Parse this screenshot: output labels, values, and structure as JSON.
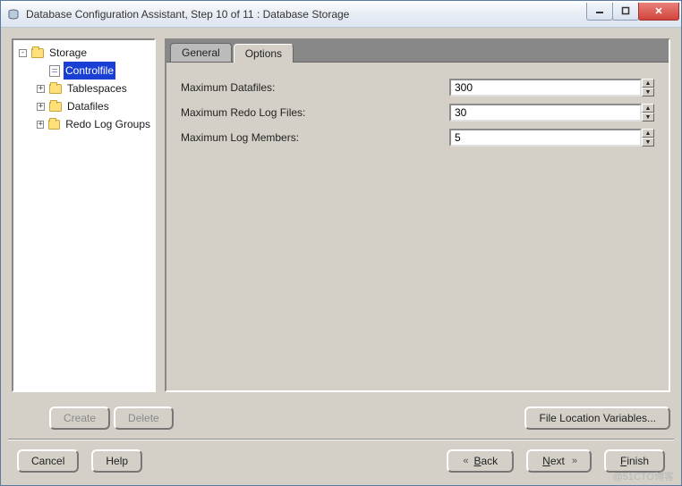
{
  "window": {
    "title": "Database Configuration Assistant, Step 10 of 11 : Database Storage"
  },
  "tree": {
    "root": {
      "label": "Storage",
      "expanded": true
    },
    "items": {
      "controlfile": "Controlfile",
      "tablespaces": "Tablespaces",
      "datafiles": "Datafiles",
      "redolog": "Redo Log Groups"
    }
  },
  "tabs": {
    "general": "General",
    "options": "Options"
  },
  "options_form": {
    "max_datafiles": {
      "label": "Maximum Datafiles:",
      "value": "300"
    },
    "max_redolog": {
      "label": "Maximum Redo Log Files:",
      "value": "30"
    },
    "max_members": {
      "label": "Maximum Log Members:",
      "value": "5"
    }
  },
  "mid_buttons": {
    "create": "Create",
    "delete": "Delete",
    "file_loc_vars": "File Location Variables..."
  },
  "nav": {
    "cancel": "Cancel",
    "help": "Help",
    "back_pre": "B",
    "back_rest": "ack",
    "next_pre": "N",
    "next_rest": "ext",
    "finish_pre": "F",
    "finish_rest": "inish"
  },
  "watermark": "@51CTO博客"
}
